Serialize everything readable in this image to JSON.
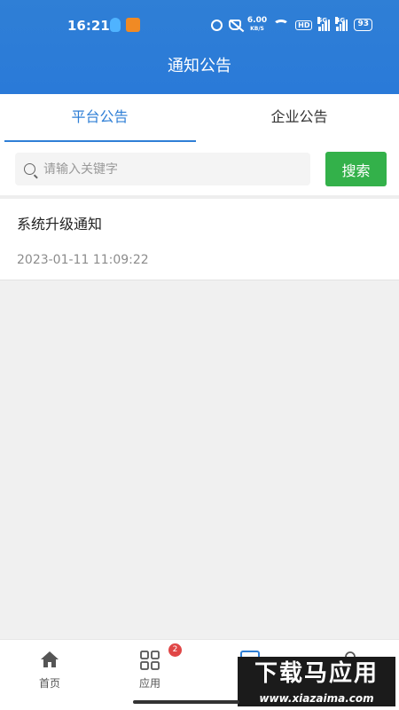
{
  "status_bar": {
    "time": "16:21",
    "speed_value": "6.00",
    "speed_unit": "KB/S",
    "hd_label": "HD",
    "signal1_label": "5G",
    "signal2_label": "4G",
    "battery": "93"
  },
  "header": {
    "title": "通知公告"
  },
  "tabs": [
    {
      "label": "平台公告",
      "active": true
    },
    {
      "label": "企业公告",
      "active": false
    }
  ],
  "search": {
    "placeholder": "请输入关键字",
    "value": "",
    "button_label": "搜索"
  },
  "notices": [
    {
      "title": "系统升级通知",
      "time": "2023-01-11 11:09:22"
    }
  ],
  "bottom_nav": [
    {
      "label": "首页",
      "icon": "home-icon"
    },
    {
      "label": "应用",
      "icon": "grid-icon",
      "badge": "2"
    },
    {
      "label": "",
      "icon": "message-icon"
    },
    {
      "label": "",
      "icon": "user-icon"
    }
  ],
  "watermark": {
    "main": "下载马应用",
    "sub": "www.xiazaima.com"
  },
  "colors": {
    "primary": "#2f7fd6",
    "search_button": "#33b14a",
    "badge": "#e04646"
  }
}
